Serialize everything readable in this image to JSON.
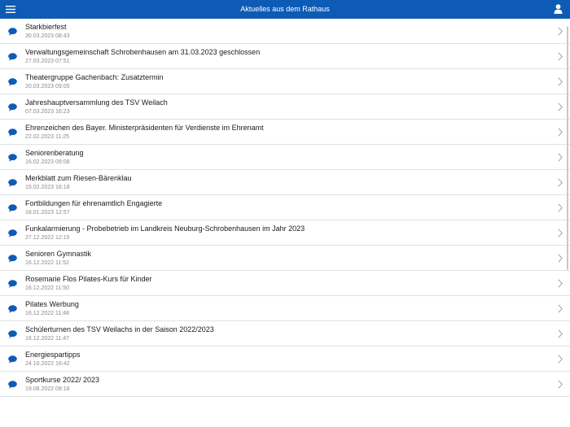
{
  "header": {
    "title": "Aktuelles aus dem Rathaus",
    "menu_icon": "hamburger-menu-icon",
    "user_icon": "user-icon",
    "color": "#0d5bb5"
  },
  "items": [
    {
      "title": "Starkbierfest",
      "date": "30.03.2023 08:43"
    },
    {
      "title": "Verwaltungsgemeinschaft Schrobenhausen am 31.03.2023 geschlossen",
      "date": "27.03.2023 07:51"
    },
    {
      "title": "Theatergruppe Gachenbach: Zusatztermin",
      "date": "20.03.2023 09:05"
    },
    {
      "title": "Jahreshauptversammlung des TSV Weilach",
      "date": "07.03.2023 16:23"
    },
    {
      "title": "Ehrenzeichen des Bayer. Ministerpräsidenten für Verdienste im Ehrenamt",
      "date": "22.02.2023 11:25"
    },
    {
      "title": "Seniorenberatung",
      "date": "16.02.2023 09:08"
    },
    {
      "title": "Merkblatt zum Riesen-Bärenklau",
      "date": "15.02.2023 16:18"
    },
    {
      "title": "Fortbildungen für ehrenamtlich Engagierte",
      "date": "18.01.2023 12:57"
    },
    {
      "title": "Funkalarmierung - Probebetrieb im Landkreis Neuburg-Schrobenhausen im Jahr 2023",
      "date": "27.12.2022 12:15"
    },
    {
      "title": "Senioren Gymnastik",
      "date": "16.12.2022 11:52"
    },
    {
      "title": "Rosemarie Flos Pilates-Kurs für Kinder",
      "date": "16.12.2022 11:50"
    },
    {
      "title": "Pilates Werbung",
      "date": "16.12.2022 11:48"
    },
    {
      "title": "Schülerturnen des TSV Weilachs in der Saison 2022/2023",
      "date": "16.12.2022 11:47"
    },
    {
      "title": "Energiespartipps",
      "date": "24.10.2022 16:42"
    },
    {
      "title": "Sportkurse 2022/ 2023",
      "date": "19.08.2022 09:18"
    }
  ],
  "icons": {
    "item_icon": "speech-bubble-icon",
    "item_icon_color": "#0d5bb5",
    "chevron_icon": "chevron-right-icon"
  }
}
